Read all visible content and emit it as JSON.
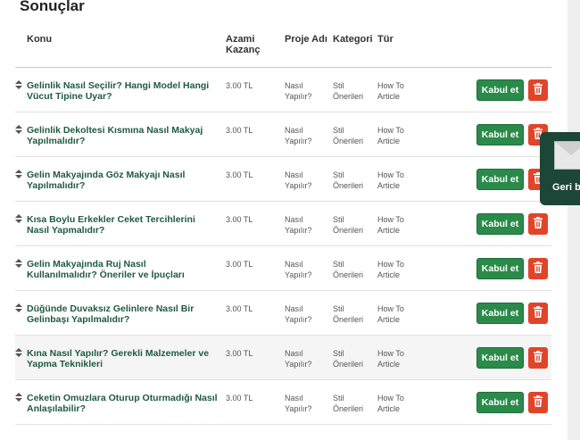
{
  "page": {
    "title": "Sonuçlar"
  },
  "table": {
    "headers": {
      "subject": "Konu",
      "price": "Azami Kazanç",
      "project": "Proje Adı",
      "category": "Kategori",
      "type": "Tür"
    },
    "rows": [
      {
        "subject": "Gelinlik Nasıl Seçilir? Hangi Model Hangi Vücut Tipine Uyar?",
        "price": "3.00 TL",
        "project": "Nasıl Yapılır?",
        "category": "Stil Önerileri",
        "type": "How To Article"
      },
      {
        "subject": "Gelinlik Dekoltesi Kısmına Nasıl Makyaj Yapılmalıdır?",
        "price": "3.00 TL",
        "project": "Nasıl Yapılır?",
        "category": "Stil Önerileri",
        "type": "How To Article"
      },
      {
        "subject": "Gelin Makyajında Göz Makyajı Nasıl Yapılmalıdır?",
        "price": "3.00 TL",
        "project": "Nasıl Yapılır?",
        "category": "Stil Önerileri",
        "type": "How To Article"
      },
      {
        "subject": "Kısa Boylu Erkekler Ceket Tercihlerini Nasıl Yapmalıdır?",
        "price": "3.00 TL",
        "project": "Nasıl Yapılır?",
        "category": "Stil Önerileri",
        "type": "How To Article"
      },
      {
        "subject": "Gelin Makyajında Ruj Nasıl Kullanılmalıdır? Öneriler ve İpuçları",
        "price": "3.00 TL",
        "project": "Nasıl Yapılır?",
        "category": "Stil Önerileri",
        "type": "How To Article"
      },
      {
        "subject": "Düğünde Duvaksız Gelinlere Nasıl Bir Gelinbaşı Yapılmalıdır?",
        "price": "3.00 TL",
        "project": "Nasıl Yapılır?",
        "category": "Stil Önerileri",
        "type": "How To Article"
      },
      {
        "subject": "Kına Nasıl Yapılır? Gerekli Malzemeler ve Yapma Teknikleri",
        "price": "3.00 TL",
        "project": "Nasıl Yapılır?",
        "category": "Stil Önerileri",
        "type": "How To Article"
      },
      {
        "subject": "Ceketin Omuzlara Oturup Oturmadığı Nasıl Anlaşılabilir?",
        "price": "3.00 TL",
        "project": "Nasıl Yapılır?",
        "category": "Stil Önerileri",
        "type": "How To Article"
      }
    ]
  },
  "actions": {
    "accept_label": "Kabul et",
    "accept_color": "#2a8a4a",
    "delete_icon": "trash-icon",
    "delete_color": "#e0452a"
  },
  "popup": {
    "label": "Geri b",
    "icon": "envelope-icon"
  },
  "colors": {
    "link": "#1f5a43",
    "popup_bg": "#1c4638"
  }
}
